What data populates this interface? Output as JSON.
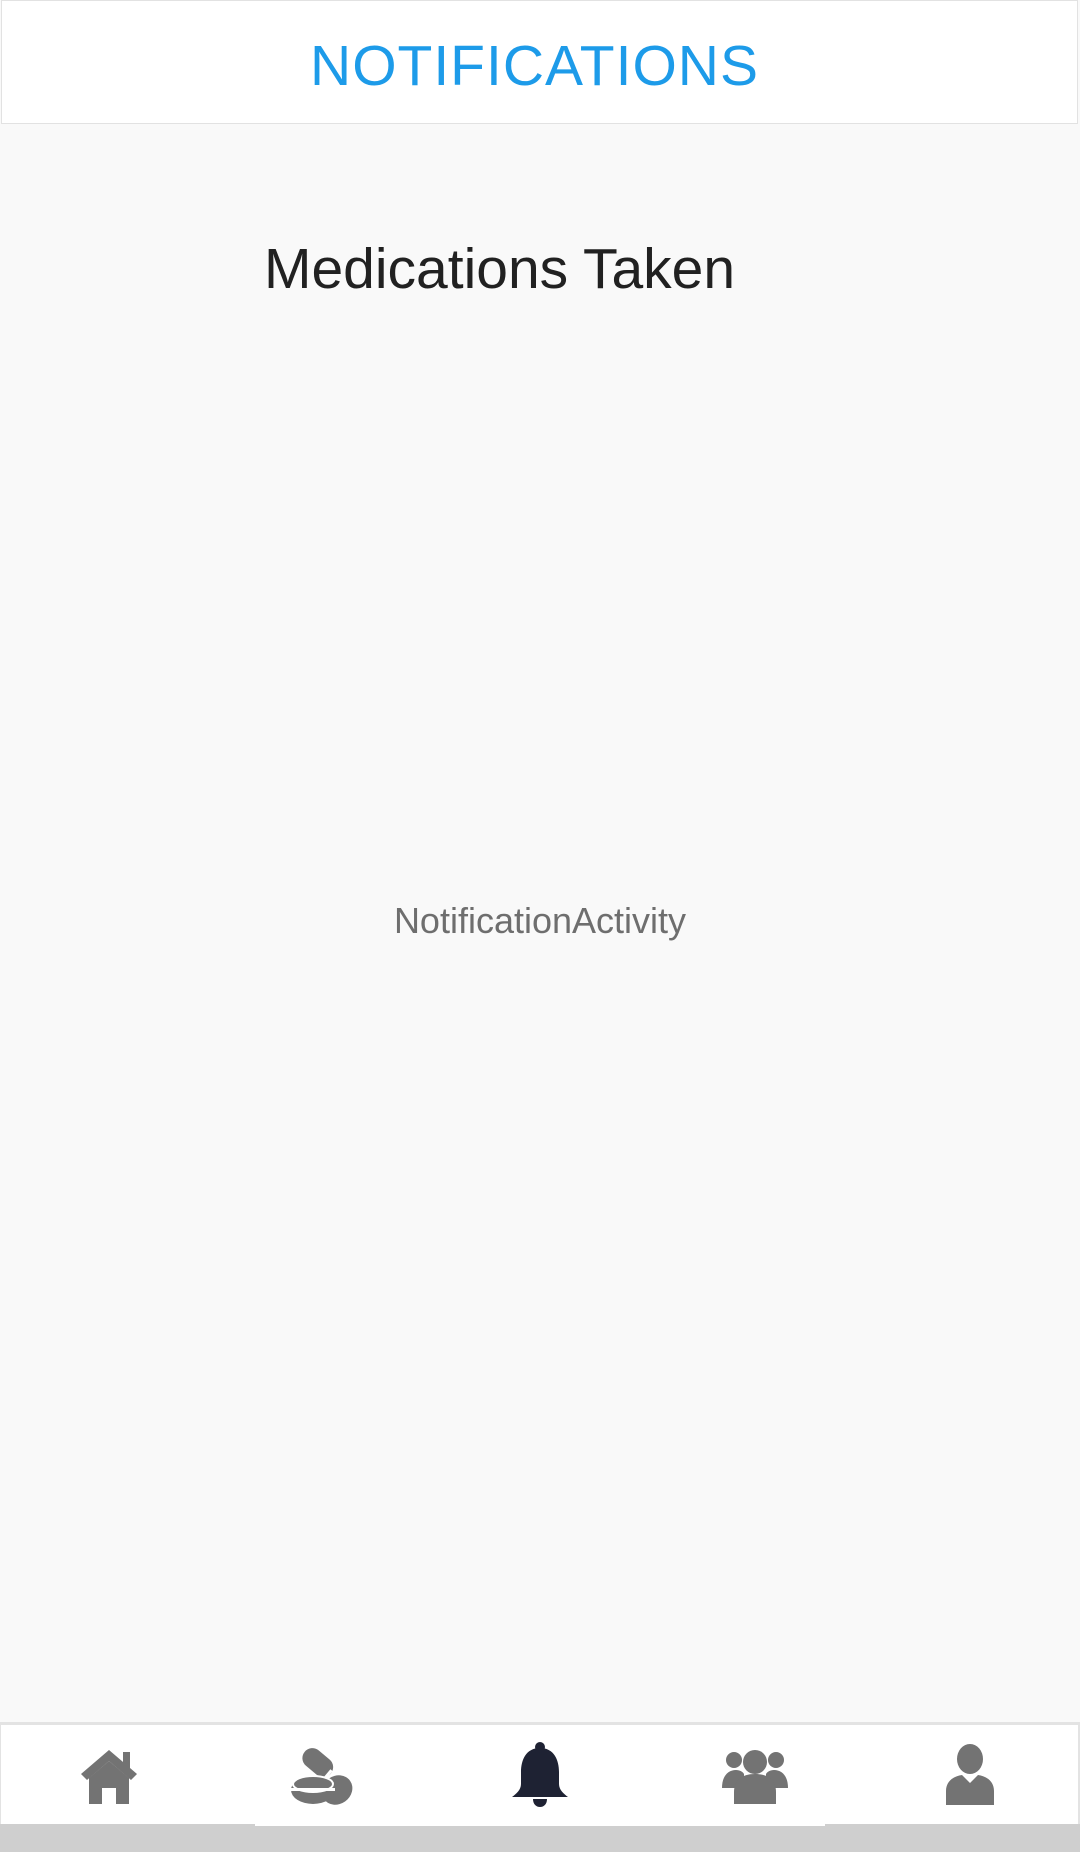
{
  "header": {
    "title": "NOTIFICATIONS"
  },
  "main": {
    "heading": "Medications Taken",
    "activity_label": "NotificationActivity"
  },
  "nav": {
    "items": [
      {
        "icon": "home-icon",
        "active": false
      },
      {
        "icon": "pills-icon",
        "active": false
      },
      {
        "icon": "bell-icon",
        "active": true
      },
      {
        "icon": "group-icon",
        "active": false
      },
      {
        "icon": "user-icon",
        "active": false
      }
    ],
    "active_color": "#1e2233",
    "inactive_color": "#737373"
  },
  "colors": {
    "accent": "#1d9be9",
    "background": "#f9f9f9"
  }
}
